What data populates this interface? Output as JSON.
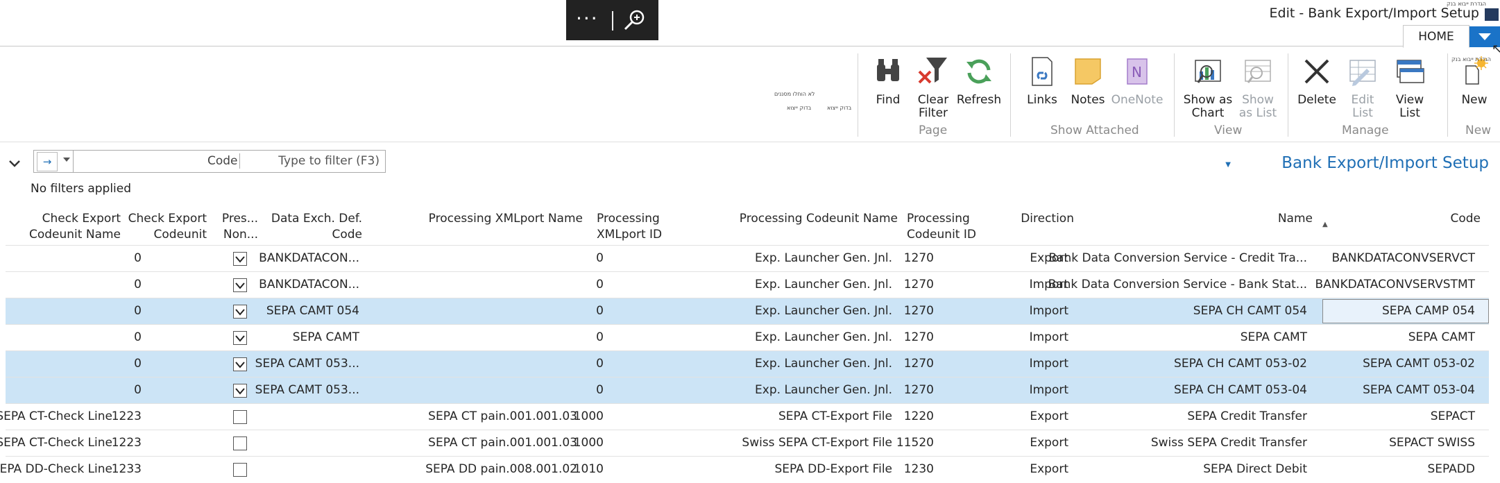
{
  "window": {
    "title": "Edit - Bank Export/Import Setup",
    "caption": "הגדרת ייבוא בנק"
  },
  "tabs": {
    "home": "HOME"
  },
  "ribbon": {
    "groups": [
      {
        "label": "New"
      },
      {
        "label": "Manage"
      },
      {
        "label": "View"
      },
      {
        "label": "Show Attached"
      },
      {
        "label": "Page"
      }
    ],
    "buttons": [
      {
        "line1": "New",
        "line2": "",
        "icon": "new-record-icon",
        "enabled": true
      },
      {
        "line1": "View",
        "line2": "List",
        "icon": "view-list-icon",
        "enabled": true
      },
      {
        "line1": "Edit",
        "line2": "List",
        "icon": "edit-list-icon",
        "enabled": false
      },
      {
        "line1": "Delete",
        "line2": "",
        "icon": "delete-icon",
        "enabled": true
      },
      {
        "line1": "Show",
        "line2": "as List",
        "icon": "show-as-list-icon",
        "enabled": false
      },
      {
        "line1": "Show as",
        "line2": "Chart",
        "icon": "show-as-chart-icon",
        "enabled": true
      },
      {
        "line1": "OneNote",
        "line2": "",
        "icon": "onenote-icon",
        "enabled": false
      },
      {
        "line1": "Notes",
        "line2": "",
        "icon": "notes-icon",
        "enabled": true
      },
      {
        "line1": "Links",
        "line2": "",
        "icon": "links-icon",
        "enabled": true
      },
      {
        "line1": "Refresh",
        "line2": "",
        "icon": "refresh-icon",
        "enabled": true
      },
      {
        "line1": "Clear",
        "line2": "Filter",
        "icon": "clear-filter-icon",
        "enabled": true
      },
      {
        "line1": "Find",
        "line2": "",
        "icon": "find-icon",
        "enabled": true
      }
    ],
    "tiny_labels": [
      "הגדרת ייבוא בנק",
      "לא הוחלו מסננים",
      "בדוק ייצוא",
      "בדוק ייצוא"
    ]
  },
  "page": {
    "title": "Bank Export/Import Setup",
    "no_filters": "No filters applied",
    "filter": {
      "placeholder": "Type to filter (F3)",
      "field": "Code"
    }
  },
  "columns": [
    {
      "line1": "Code",
      "line2": ""
    },
    {
      "line1": "Name",
      "line2": ""
    },
    {
      "line1": "Direction",
      "line2": ""
    },
    {
      "line1": "Processing",
      "line2": "Codeunit ID"
    },
    {
      "line1": "Processing Codeunit Name",
      "line2": ""
    },
    {
      "line1": "Processing",
      "line2": "XMLport ID"
    },
    {
      "line1": "Processing XMLport Name",
      "line2": ""
    },
    {
      "line1": "Data Exch. Def.",
      "line2": "Code"
    },
    {
      "line1": "Pres...",
      "line2": "Non..."
    },
    {
      "line1": "Check Export",
      "line2": "Codeunit"
    },
    {
      "line1": "Check Export",
      "line2": "Codeunit Name"
    }
  ],
  "rows": [
    {
      "code": "BANKDATACONVSERVCT",
      "name": "Bank Data Conversion Service - Credit Tra...",
      "direction": "Export",
      "proc_cu_id": "1270",
      "proc_cu_name": "Exp. Launcher Gen. Jnl.",
      "xmlport_id": "0",
      "xmlport_name": "",
      "data_exch": "BANKDATACON...",
      "preserve": true,
      "check_cu": "0",
      "check_cu_name": "",
      "selected": false,
      "focused": false
    },
    {
      "code": "BANKDATACONVSERVSTMT",
      "name": "Bank Data Conversion Service - Bank Stat...",
      "direction": "Import",
      "proc_cu_id": "1270",
      "proc_cu_name": "Exp. Launcher Gen. Jnl.",
      "xmlport_id": "0",
      "xmlport_name": "",
      "data_exch": "BANKDATACON...",
      "preserve": true,
      "check_cu": "0",
      "check_cu_name": "",
      "selected": false,
      "focused": false
    },
    {
      "code": "SEPA CAMP 054",
      "name": "SEPA CH CAMT 054",
      "direction": "Import",
      "proc_cu_id": "1270",
      "proc_cu_name": "Exp. Launcher Gen. Jnl.",
      "xmlport_id": "0",
      "xmlport_name": "",
      "data_exch": "SEPA CAMT 054",
      "preserve": true,
      "check_cu": "0",
      "check_cu_name": "",
      "selected": true,
      "focused": true
    },
    {
      "code": "SEPA CAMT",
      "name": "SEPA CAMT",
      "direction": "Import",
      "proc_cu_id": "1270",
      "proc_cu_name": "Exp. Launcher Gen. Jnl.",
      "xmlport_id": "0",
      "xmlport_name": "",
      "data_exch": "SEPA CAMT",
      "preserve": true,
      "check_cu": "0",
      "check_cu_name": "",
      "selected": false,
      "focused": false
    },
    {
      "code": "SEPA CAMT 053-02",
      "name": "SEPA CH CAMT 053-02",
      "direction": "Import",
      "proc_cu_id": "1270",
      "proc_cu_name": "Exp. Launcher Gen. Jnl.",
      "xmlport_id": "0",
      "xmlport_name": "",
      "data_exch": "SEPA CAMT 053...",
      "preserve": true,
      "check_cu": "0",
      "check_cu_name": "",
      "selected": true,
      "focused": false
    },
    {
      "code": "SEPA CAMT 053-04",
      "name": "SEPA CH CAMT 053-04",
      "direction": "Import",
      "proc_cu_id": "1270",
      "proc_cu_name": "Exp. Launcher Gen. Jnl.",
      "xmlport_id": "0",
      "xmlport_name": "",
      "data_exch": "SEPA CAMT 053...",
      "preserve": true,
      "check_cu": "0",
      "check_cu_name": "",
      "selected": true,
      "focused": false
    },
    {
      "code": "SEPACT",
      "name": "SEPA Credit Transfer",
      "direction": "Export",
      "proc_cu_id": "1220",
      "proc_cu_name": "SEPA CT-Export File",
      "xmlport_id": "1000",
      "xmlport_name": "SEPA CT pain.001.001.03",
      "data_exch": "",
      "preserve": false,
      "check_cu": "1223",
      "check_cu_name": "SEPA CT-Check Line",
      "selected": false,
      "focused": false
    },
    {
      "code": "SEPACT SWISS",
      "name": "Swiss SEPA Credit Transfer",
      "direction": "Export",
      "proc_cu_id": "11520",
      "proc_cu_name": "Swiss SEPA CT-Export File",
      "xmlport_id": "1000",
      "xmlport_name": "SEPA CT pain.001.001.03",
      "data_exch": "",
      "preserve": false,
      "check_cu": "1223",
      "check_cu_name": "SEPA CT-Check Line",
      "selected": false,
      "focused": false
    },
    {
      "code": "SEPADD",
      "name": "SEPA Direct Debit",
      "direction": "Export",
      "proc_cu_id": "1230",
      "proc_cu_name": "SEPA DD-Export File",
      "xmlport_id": "1010",
      "xmlport_name": "SEPA DD pain.008.001.02",
      "data_exch": "",
      "preserve": false,
      "check_cu": "1233",
      "check_cu_name": "SEPA DD-Check Line",
      "selected": false,
      "focused": false
    }
  ]
}
